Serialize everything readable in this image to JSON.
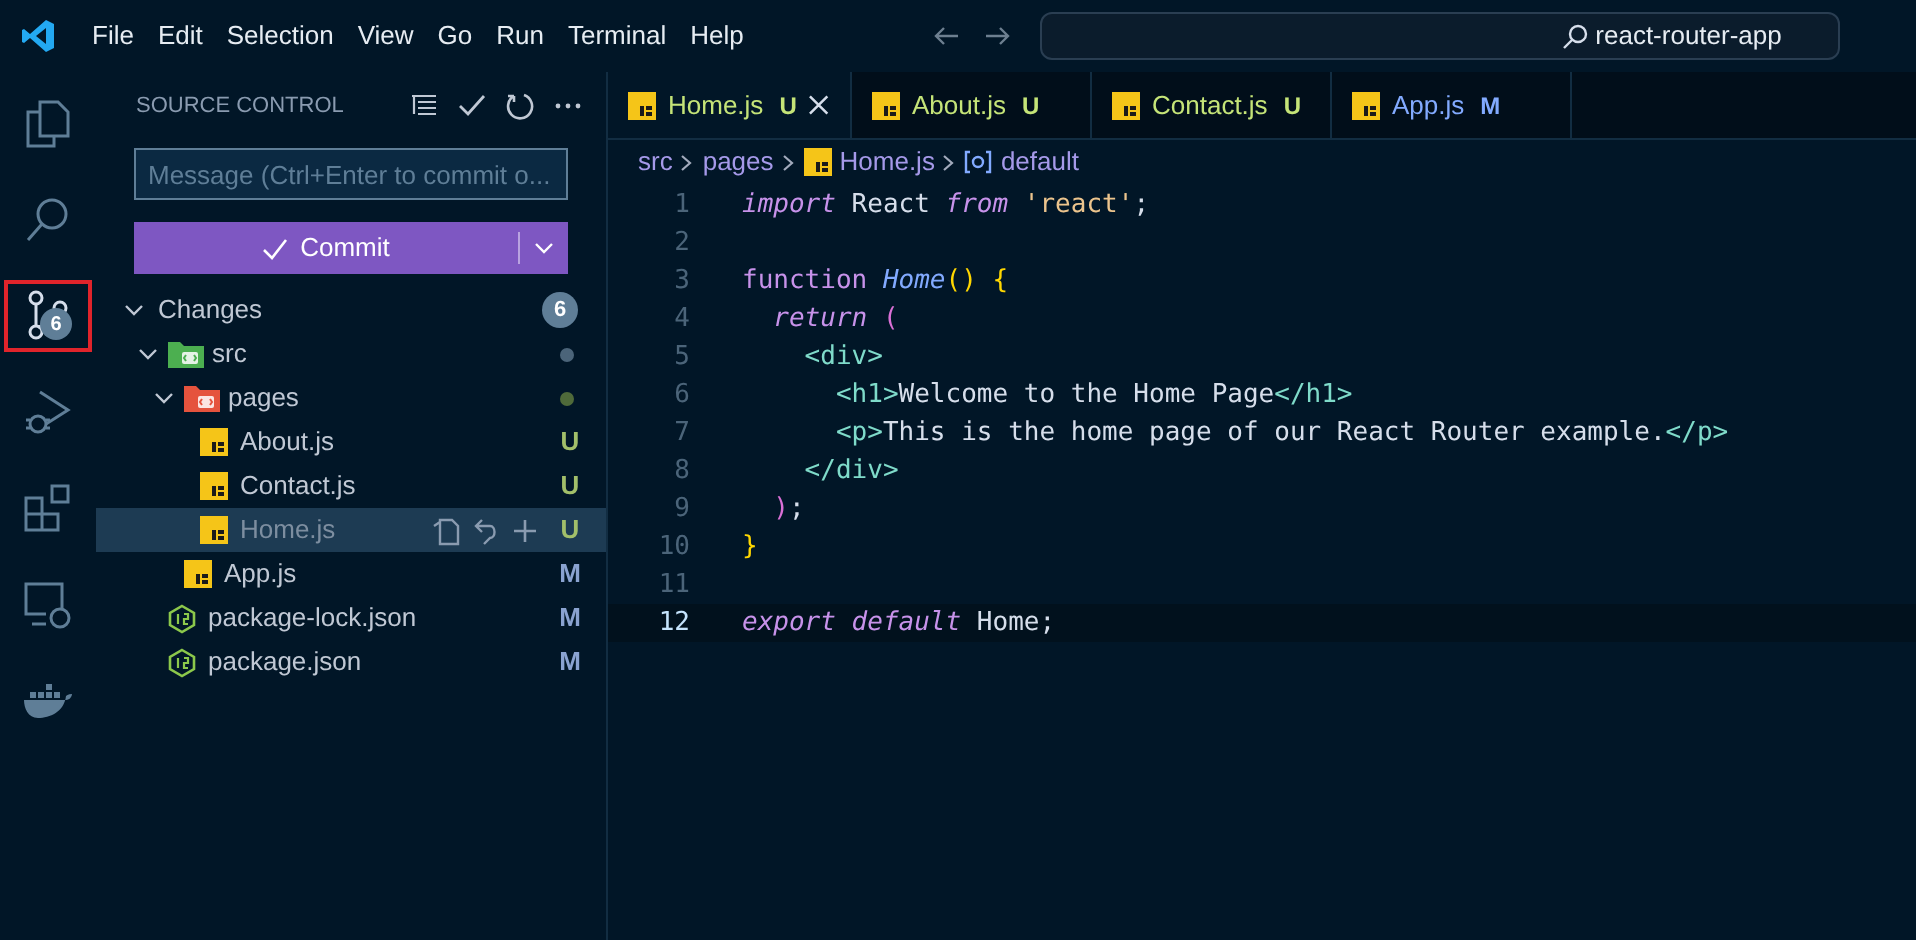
{
  "title_bar": {
    "menu": [
      "File",
      "Edit",
      "Selection",
      "View",
      "Go",
      "Run",
      "Terminal",
      "Help"
    ],
    "search": "react-router-app"
  },
  "activity_bar": [
    {
      "kind": "explorer",
      "selected": false
    },
    {
      "kind": "search",
      "selected": false
    },
    {
      "kind": "source-control",
      "selected": true,
      "badge": "6"
    },
    {
      "kind": "run",
      "selected": false
    },
    {
      "kind": "extensions",
      "selected": false
    },
    {
      "kind": "remote",
      "selected": false
    },
    {
      "kind": "docker",
      "selected": false
    }
  ],
  "sidebar": {
    "title": "SOURCE CONTROL",
    "message_placeholder": "Message (Ctrl+Enter to commit o...",
    "commit_label": "Commit",
    "changes": {
      "label": "Changes",
      "count": "6",
      "expanded": true,
      "children": [
        {
          "kind": "folder",
          "name": "src",
          "expanded": true,
          "color": "#4b6479",
          "children": [
            {
              "kind": "folder",
              "name": "pages",
              "expanded": true,
              "color": "#4f6a3a",
              "children": [
                {
                  "kind": "js",
                  "name": "About.js",
                  "status": "U",
                  "color": "#a2bf6a",
                  "selected": false
                },
                {
                  "kind": "js",
                  "name": "Contact.js",
                  "status": "U",
                  "color": "#a2bf6a",
                  "selected": false
                },
                {
                  "kind": "js",
                  "name": "Home.js",
                  "status": "U",
                  "color": "#a2bf6a",
                  "selected": true
                }
              ]
            },
            {
              "kind": "js",
              "name": "App.js",
              "status": "M",
              "color": "#8aa3d1",
              "selected": false
            }
          ]
        },
        {
          "kind": "json",
          "name": "package-lock.json",
          "status": "M",
          "color": "#8aa3d1",
          "selected": false
        },
        {
          "kind": "json",
          "name": "package.json",
          "status": "M",
          "color": "#8aa3d1",
          "selected": false
        }
      ]
    }
  },
  "tabs": [
    {
      "label": "Home.js",
      "status": "U",
      "color": "#c5e478",
      "selected": true
    },
    {
      "label": "About.js",
      "status": "U",
      "color": "#c5e478",
      "selected": false
    },
    {
      "label": "Contact.js",
      "status": "U",
      "color": "#c5e478",
      "selected": false
    },
    {
      "label": "App.js",
      "status": "M",
      "color": "#82aaff",
      "selected": false
    }
  ],
  "breadcrumb": [
    "src",
    "pages",
    "Home.js",
    "default"
  ],
  "code": [
    {
      "number": "1",
      "current": false,
      "tokens": [
        {
          "kind": "keyword",
          "text": "import"
        },
        {
          "kind": "plain",
          "text": " React "
        },
        {
          "kind": "keyword",
          "text": "from"
        },
        {
          "kind": "string",
          "text": " 'react'"
        },
        {
          "kind": "plain",
          "text": ";"
        }
      ]
    },
    {
      "number": "2",
      "current": false
    },
    {
      "number": "3",
      "current": false,
      "tokens": [
        {
          "kind": "storage",
          "text": "function"
        },
        {
          "kind": "function",
          "text": " Home"
        },
        {
          "kind": "brace",
          "text": "() {"
        }
      ]
    },
    {
      "number": "4",
      "current": false,
      "tokens": [
        {
          "kind": "keyword",
          "text": "  return"
        },
        {
          "kind": "paren",
          "text": " ("
        }
      ]
    },
    {
      "number": "5",
      "current": false,
      "tokens": [
        {
          "kind": "tag",
          "text": "    <div>"
        }
      ]
    },
    {
      "number": "6",
      "current": false,
      "tokens": [
        {
          "kind": "tag",
          "text": "      <h1>"
        },
        {
          "kind": "plain",
          "text": "Welcome to the Home Page"
        },
        {
          "kind": "tag",
          "text": "</h1>"
        }
      ]
    },
    {
      "number": "7",
      "current": false,
      "tokens": [
        {
          "kind": "tag",
          "text": "      <p>"
        },
        {
          "kind": "plain",
          "text": "This is the home page of our React Router example."
        },
        {
          "kind": "tag",
          "text": "</p>"
        }
      ]
    },
    {
      "number": "8",
      "current": false,
      "tokens": [
        {
          "kind": "tag",
          "text": "    </div>"
        }
      ]
    },
    {
      "number": "9",
      "current": false,
      "tokens": [
        {
          "kind": "paren",
          "text": "  )"
        },
        {
          "kind": "plain",
          "text": ";"
        }
      ]
    },
    {
      "number": "10",
      "current": false,
      "tokens": [
        {
          "kind": "brace",
          "text": "}"
        }
      ]
    },
    {
      "number": "11",
      "current": false
    },
    {
      "number": "12",
      "current": true,
      "tokens": [
        {
          "kind": "keyword",
          "text": "export"
        },
        {
          "kind": "keyword",
          "text": " default"
        },
        {
          "kind": "plain",
          "text": " Home;"
        }
      ]
    }
  ]
}
